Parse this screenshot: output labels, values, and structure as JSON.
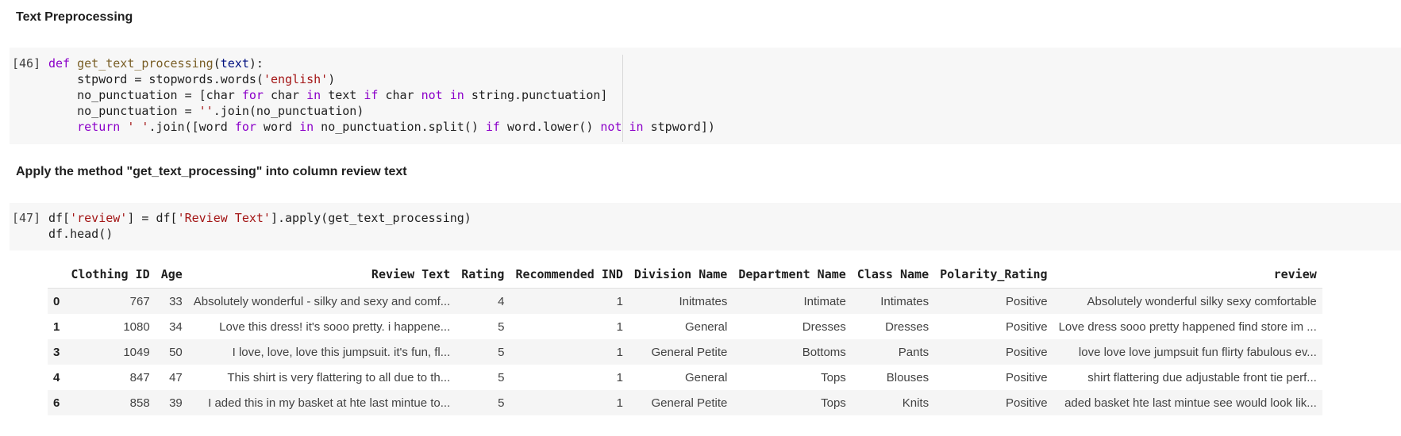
{
  "headings": {
    "text_preprocessing": "Text Preprocessing",
    "apply_method": "Apply the method \"get_text_processing\" into column review text"
  },
  "cells": [
    {
      "prompt": "[46]",
      "lines": [
        [
          {
            "t": "def",
            "c": "kw"
          },
          {
            "t": " ",
            "c": ""
          },
          {
            "t": "get_text_processing",
            "c": "fn"
          },
          {
            "t": "(",
            "c": ""
          },
          {
            "t": "text",
            "c": "prm"
          },
          {
            "t": "):",
            "c": ""
          }
        ],
        [
          {
            "t": "    stpword = stopwords.words(",
            "c": ""
          },
          {
            "t": "'english'",
            "c": "str"
          },
          {
            "t": ")",
            "c": ""
          }
        ],
        [
          {
            "t": "    no_punctuation = [char ",
            "c": ""
          },
          {
            "t": "for",
            "c": "kw"
          },
          {
            "t": " char ",
            "c": ""
          },
          {
            "t": "in",
            "c": "kw"
          },
          {
            "t": " text ",
            "c": ""
          },
          {
            "t": "if",
            "c": "kw"
          },
          {
            "t": " char ",
            "c": ""
          },
          {
            "t": "not",
            "c": "kw"
          },
          {
            "t": " ",
            "c": ""
          },
          {
            "t": "in",
            "c": "kw"
          },
          {
            "t": " string.punctuation]",
            "c": ""
          }
        ],
        [
          {
            "t": "    no_punctuation = ",
            "c": ""
          },
          {
            "t": "''",
            "c": "str"
          },
          {
            "t": ".join(no_punctuation)",
            "c": ""
          }
        ],
        [
          {
            "t": "    ",
            "c": ""
          },
          {
            "t": "return",
            "c": "kw"
          },
          {
            "t": " ",
            "c": ""
          },
          {
            "t": "' '",
            "c": "str"
          },
          {
            "t": ".join([word ",
            "c": ""
          },
          {
            "t": "for",
            "c": "kw"
          },
          {
            "t": " word ",
            "c": ""
          },
          {
            "t": "in",
            "c": "kw"
          },
          {
            "t": " no_punctuation.split() ",
            "c": ""
          },
          {
            "t": "if",
            "c": "kw"
          },
          {
            "t": " word.lower() ",
            "c": ""
          },
          {
            "t": "not",
            "c": "kw"
          },
          {
            "t": " ",
            "c": ""
          },
          {
            "t": "in",
            "c": "kw"
          },
          {
            "t": " stpword])",
            "c": ""
          }
        ]
      ]
    },
    {
      "prompt": "[47]",
      "lines": [
        [
          {
            "t": "df[",
            "c": ""
          },
          {
            "t": "'review'",
            "c": "str"
          },
          {
            "t": "] = df[",
            "c": ""
          },
          {
            "t": "'Review Text'",
            "c": "str"
          },
          {
            "t": "].apply(get_text_processing)",
            "c": ""
          }
        ],
        [
          {
            "t": "df.head()",
            "c": ""
          }
        ]
      ]
    }
  ],
  "table": {
    "columns": [
      "",
      "Clothing ID",
      "Age",
      "Review Text",
      "Rating",
      "Recommended IND",
      "Division Name",
      "Department Name",
      "Class Name",
      "Polarity_Rating",
      "review"
    ],
    "rows": [
      [
        "0",
        "767",
        "33",
        "Absolutely wonderful - silky and sexy and comf...",
        "4",
        "1",
        "Initmates",
        "Intimate",
        "Intimates",
        "Positive",
        "Absolutely wonderful silky sexy comfortable"
      ],
      [
        "1",
        "1080",
        "34",
        "Love this dress! it's sooo pretty. i happene...",
        "5",
        "1",
        "General",
        "Dresses",
        "Dresses",
        "Positive",
        "Love dress sooo pretty happened find store im ..."
      ],
      [
        "3",
        "1049",
        "50",
        "I love, love, love this jumpsuit. it's fun, fl...",
        "5",
        "1",
        "General Petite",
        "Bottoms",
        "Pants",
        "Positive",
        "love love love jumpsuit fun flirty fabulous ev..."
      ],
      [
        "4",
        "847",
        "47",
        "This shirt is very flattering to all due to th...",
        "5",
        "1",
        "General",
        "Tops",
        "Blouses",
        "Positive",
        "shirt flattering due adjustable front tie perf..."
      ],
      [
        "6",
        "858",
        "39",
        "I aded this in my basket at hte last mintue to...",
        "5",
        "1",
        "General Petite",
        "Tops",
        "Knits",
        "Positive",
        "aded basket hte last mintue see would look lik..."
      ]
    ]
  }
}
